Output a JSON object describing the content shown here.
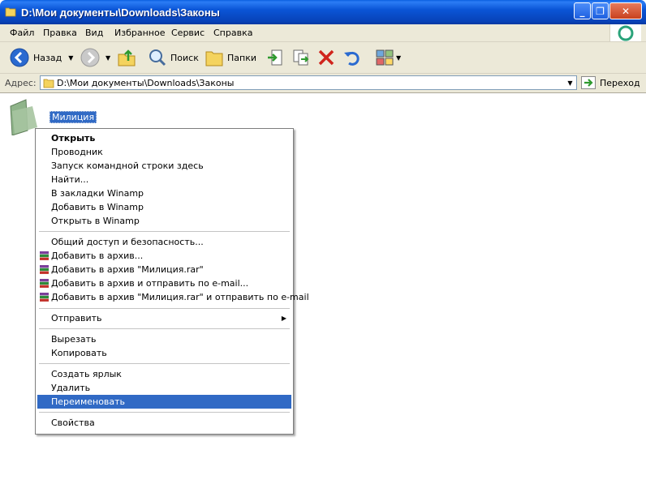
{
  "window": {
    "title": "D:\\Мои документы\\Downloads\\Законы"
  },
  "menubar": [
    "Файл",
    "Правка",
    "Вид",
    "Избранное",
    "Сервис",
    "Справка"
  ],
  "toolbar": {
    "back": "Назад",
    "search": "Поиск",
    "folders": "Папки"
  },
  "address": {
    "label": "Адрес:",
    "value": "D:\\Мои документы\\Downloads\\Законы",
    "go": "Переход"
  },
  "folder": {
    "name": "Милиция"
  },
  "context_menu": {
    "open": "Открыть",
    "explorer": "Проводник",
    "cmd": "Запуск командной строки здесь",
    "find": "Найти...",
    "winamp_bookmark": "В закладки Winamp",
    "winamp_add": "Добавить в Winamp",
    "winamp_open": "Открыть в Winamp",
    "sharing": "Общий доступ и безопасность...",
    "rar_add": "Добавить в архив...",
    "rar_add_named": "Добавить в архив \"Милиция.rar\"",
    "rar_email": "Добавить в архив и отправить по e-mail...",
    "rar_named_email": "Добавить в архив \"Милиция.rar\" и отправить по e-mail",
    "send_to": "Отправить",
    "cut": "Вырезать",
    "copy": "Копировать",
    "shortcut": "Создать ярлык",
    "delete": "Удалить",
    "rename": "Переименовать",
    "properties": "Свойства"
  },
  "colors": {
    "titlebar": "#0a55d6",
    "highlight": "#316ac5",
    "chrome": "#ece9d8"
  }
}
